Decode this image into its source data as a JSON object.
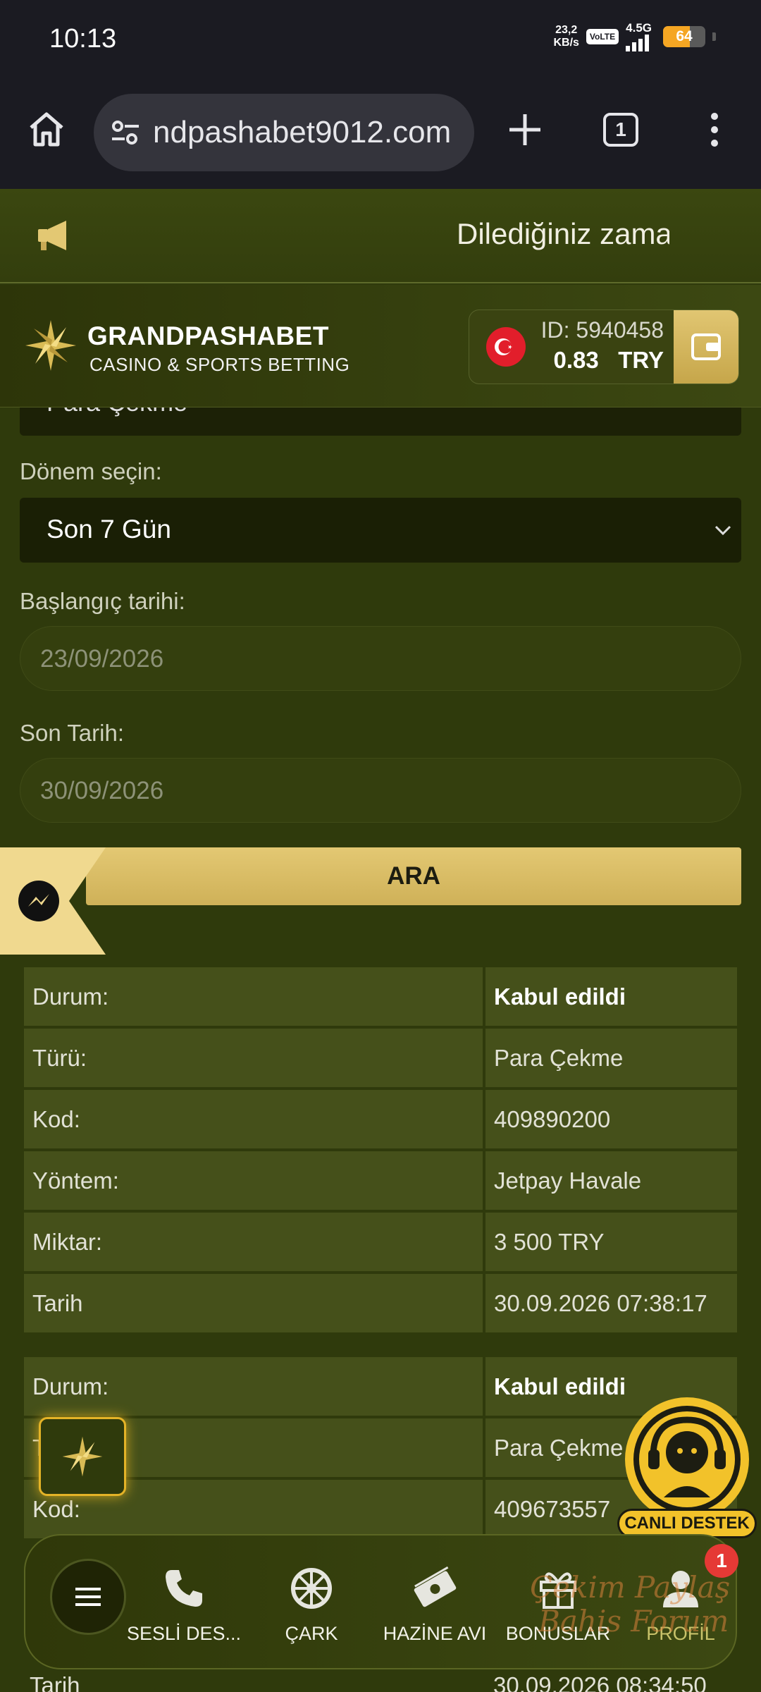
{
  "status_bar": {
    "time": "10:13",
    "speed_value": "23,2",
    "speed_unit": "KB/s",
    "volte": "VoLTE",
    "network": "4.5G",
    "battery": "64",
    "battery_level": 0.64
  },
  "browser": {
    "url": "ndpashabet9012.com",
    "tab_count": "1"
  },
  "marquee": {
    "text": "Dilediğiniz zama"
  },
  "header": {
    "brand": "GRANDPASHABET",
    "tagline": "CASINO & SPORTS BETTING",
    "account_id": "ID: 5940458",
    "balance": "0.83",
    "currency": "TRY"
  },
  "form": {
    "type_value_partial": "Para Çekme",
    "period_label": "Dönem seçin:",
    "period_value": "Son 7 Gün",
    "start_label": "Başlangıç tarihi:",
    "start_value": "23/09/2026",
    "end_label": "Son Tarih:",
    "end_value": "30/09/2026",
    "search_button": "ARA"
  },
  "transactions": [
    {
      "status_label": "Durum:",
      "status": "Kabul edildi",
      "type_label": "Türü:",
      "type": "Para Çekme",
      "code_label": "Kod:",
      "code": "409890200",
      "method_label": "Yöntem:",
      "method": "Jetpay Havale",
      "amount_label": "Miktar:",
      "amount": "3 500 TRY",
      "date_label": "Tarih",
      "date": "30.09.2026 07:38:17"
    },
    {
      "status_label": "Durum:",
      "status": "Kabul edildi",
      "type_label": "T",
      "type": "Para Çekme",
      "code_label": "Kod:",
      "code": "409673557",
      "date_label": "Tarih",
      "date": "30.09.2026 08:34:50"
    }
  ],
  "live_support": "CANLI DESTEK",
  "bottom_nav": {
    "items": [
      "SESLİ DES...",
      "ÇARK",
      "HAZİNE AVI",
      "BONUSLAR",
      "PROFİL"
    ],
    "profile_badge": "1"
  },
  "watermark": {
    "line1": "Çekim Paylaş",
    "line2": "Bahis Forum"
  },
  "colors": {
    "gold": "#e3c873",
    "bg": "#2f3a0c",
    "badge": "#e53935"
  }
}
